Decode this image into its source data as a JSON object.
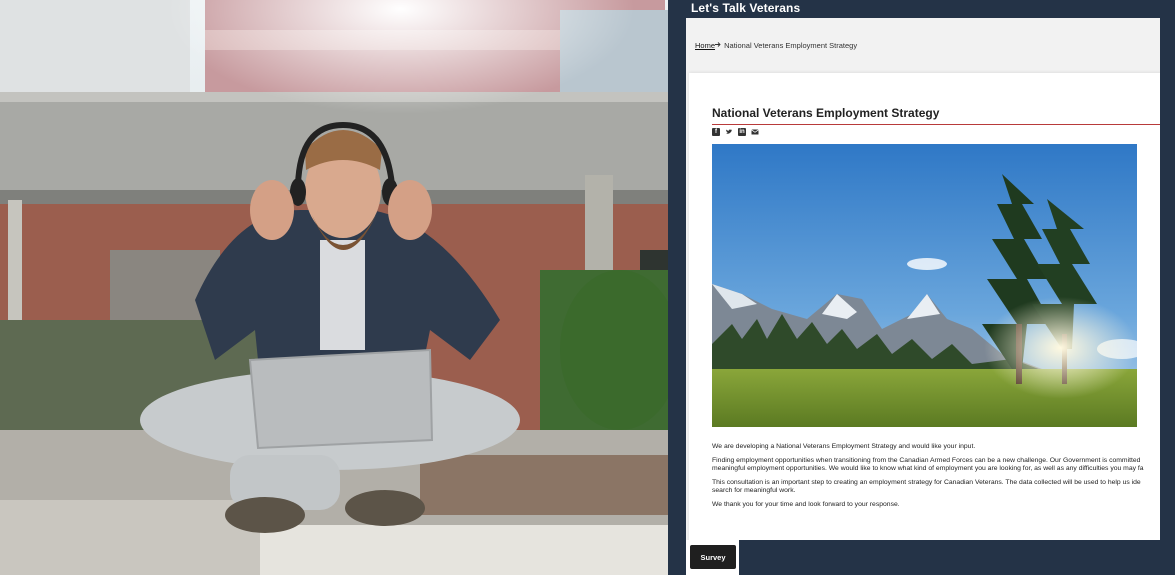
{
  "app": {
    "title": "Let's Talk Veterans"
  },
  "breadcrumb": {
    "home": "Home",
    "current": "National Veterans Employment Strategy"
  },
  "article": {
    "title": "National Veterans Employment Strategy",
    "share_icons": [
      "facebook-icon",
      "twitter-icon",
      "linkedin-icon",
      "email-icon"
    ],
    "paragraphs": [
      "We are developing a National Veterans Employment Strategy and would like your input.",
      "Finding employment opportunities when transitioning from the Canadian Armed Forces can be a new challenge. Our Government is committed",
      "meaningful employment opportunities. We would like to know what kind of employment you are looking for, as well as any difficulties you may fa",
      "This consultation is an important step to creating an employment strategy for Canadian Veterans. The data collected will be used to help us ide",
      "search for meaningful work.",
      "We thank you for your time and look forward to your response."
    ]
  },
  "survey_button": {
    "label": "Survey"
  },
  "colors": {
    "header_bg": "#243347",
    "accent_rule": "#b83a3a",
    "button_bg": "#1f1f1f"
  }
}
